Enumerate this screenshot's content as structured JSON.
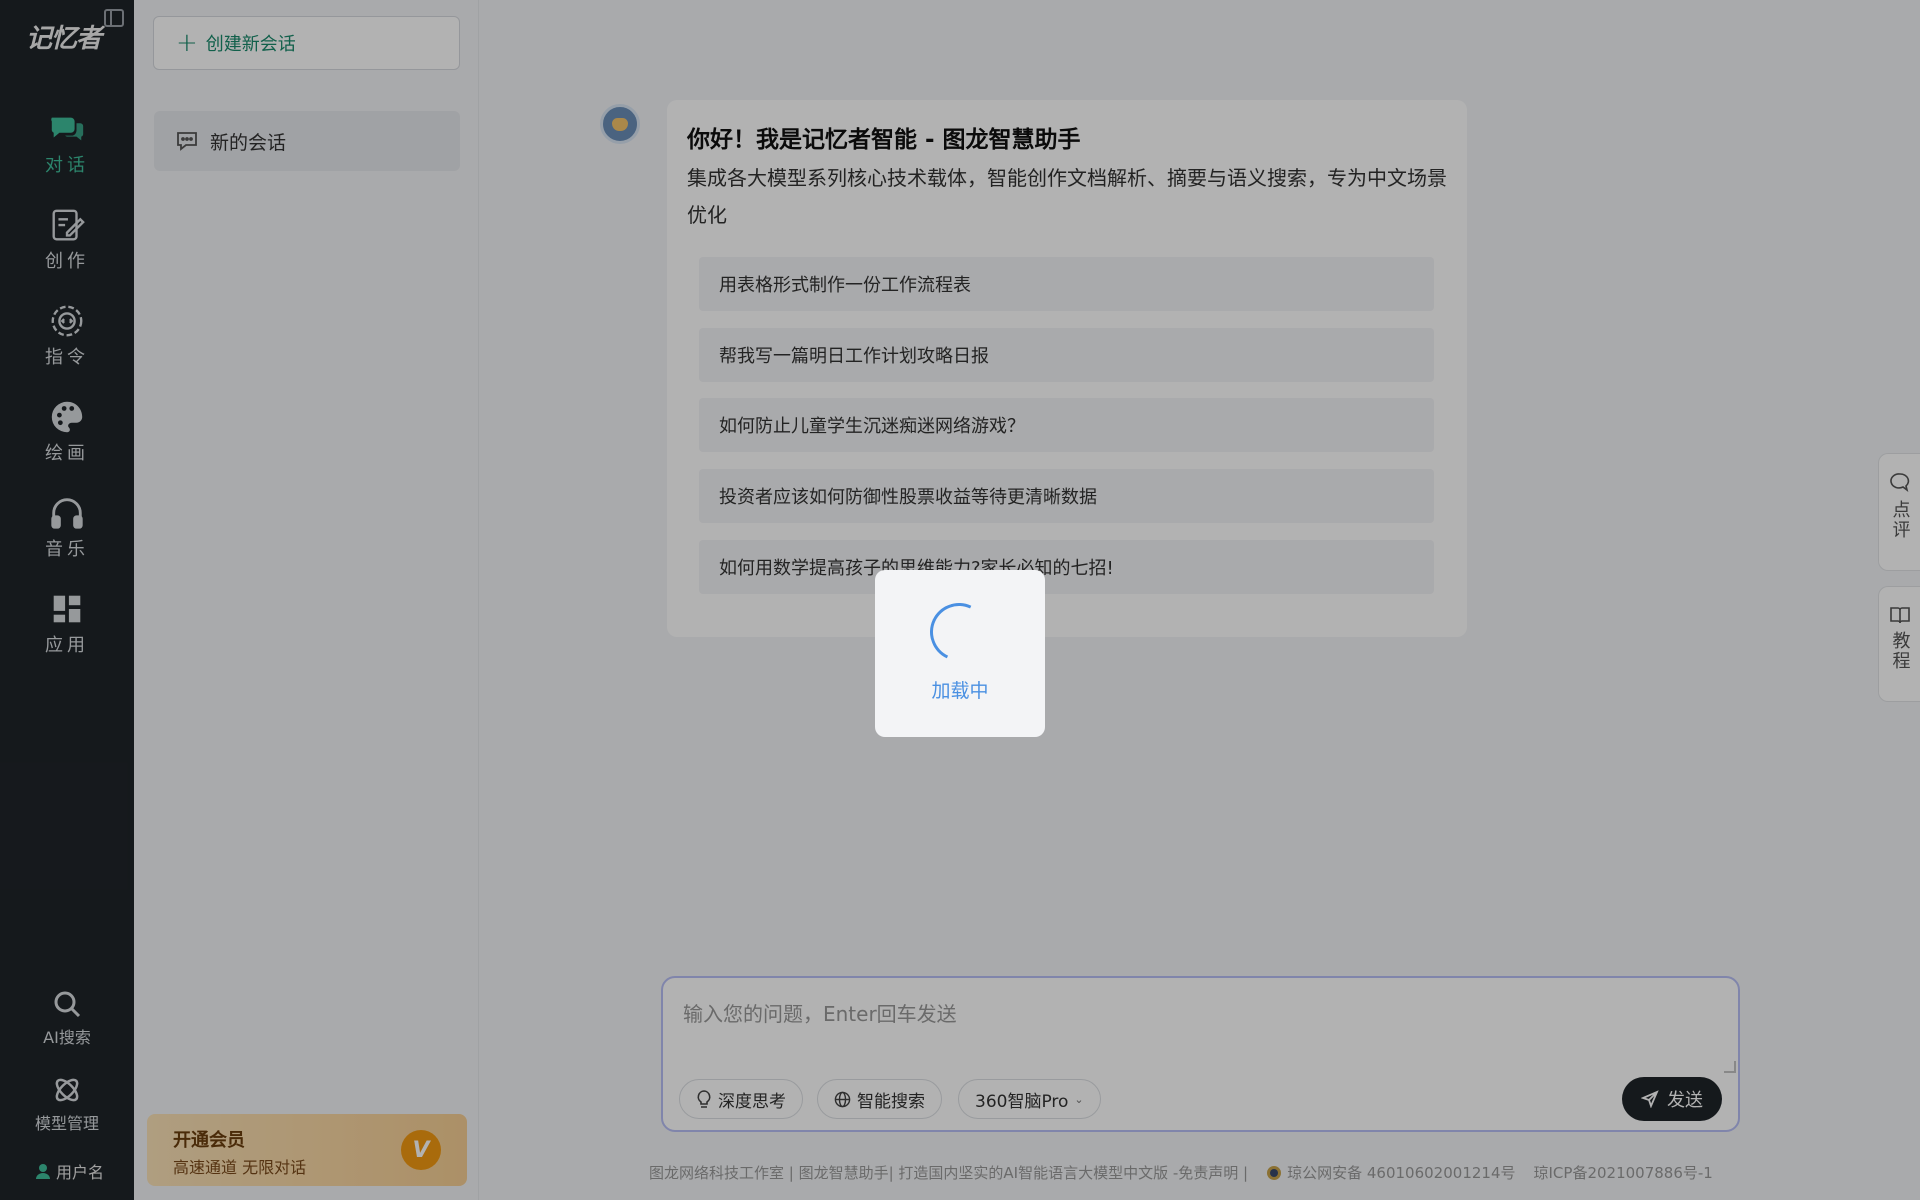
{
  "app": {
    "logo_text": "记忆者"
  },
  "rail": {
    "items": [
      {
        "label": "对话",
        "icon": "chat-bubbles-icon",
        "active": true
      },
      {
        "label": "创作",
        "icon": "edit-document-icon"
      },
      {
        "label": "指令",
        "icon": "gear-code-icon"
      },
      {
        "label": "绘画",
        "icon": "palette-icon"
      },
      {
        "label": "音乐",
        "icon": "headphones-icon"
      },
      {
        "label": "应用",
        "icon": "apps-grid-icon"
      }
    ],
    "ai_search": "AI搜索",
    "model_manage": "模型管理",
    "user_name": "用户名"
  },
  "panel": {
    "new_chat": "创建新会话",
    "sessions": [
      "新的会话"
    ],
    "vip_title": "开通会员",
    "vip_subtitle": "高速通道 无限对话",
    "vip_badge": "V"
  },
  "welcome": {
    "title": "你好！我是记忆者智能 - 图龙智慧助手",
    "description": "集成各大模型系列核心技术载体，智能创作文档解析、摘要与语义搜索，专为中文场景优化",
    "suggestions": [
      "用表格形式制作一份工作流程表",
      "帮我写一篇明日工作计划攻略日报",
      "如何防止儿童学生沉迷痴迷网络游戏？",
      "投资者应该如何防御性股票收益等待更清晰数据",
      "如何用数学提高孩子的思维能力?家长必知的七招!"
    ]
  },
  "composer": {
    "placeholder": "输入您的问题，Enter回车发送",
    "deep_think": "深度思考",
    "smart_search": "智能搜索",
    "model_select": "360智脑Pro",
    "send": "发送"
  },
  "footer": {
    "text1": "图龙网络科技工作室 | 图龙智慧助手| 打造国内坚实的AI智能语言大模型中文版 -免责声明 |",
    "police_record": "琼公网安备 46010602001214号",
    "icp": "琼ICP备2021007886号-1"
  },
  "side_tabs": {
    "review": "点评",
    "tutorial": "教程"
  },
  "loading": {
    "text": "加载中"
  },
  "colors": {
    "accent": "#1a8a6c",
    "rail_bg": "#1f2429",
    "loader_blue": "#4a90e2"
  }
}
